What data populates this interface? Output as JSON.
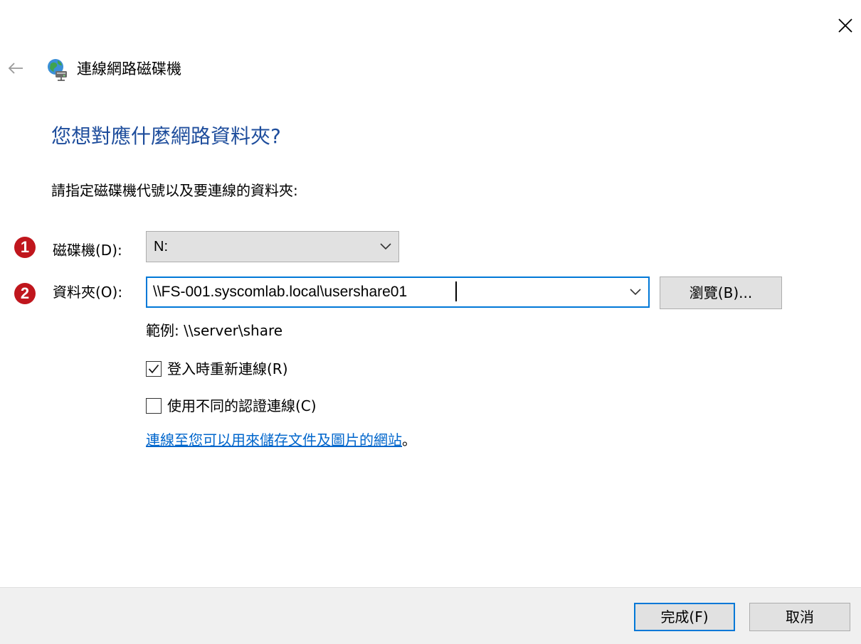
{
  "window": {
    "title": "連線網路磁碟機",
    "close_icon": "close-icon",
    "back_icon": "back-arrow-icon",
    "app_icon": "network-drive-icon"
  },
  "main": {
    "heading": "您想對應什麼網路資料夾?",
    "instruction": "請指定磁碟機代號以及要連線的資料夾:",
    "badges": [
      "1",
      "2"
    ],
    "drive": {
      "label": "磁碟機(D):",
      "value": "N:"
    },
    "folder": {
      "label": "資料夾(O):",
      "value": "\\\\FS-001.syscomlab.local\\usershare01"
    },
    "browse_label": "瀏覽(B)...",
    "example": "範例: \\\\server\\share",
    "reconnect": {
      "label": "登入時重新連線(R)",
      "checked": true
    },
    "different_creds": {
      "label": "使用不同的認證連線(C)",
      "checked": false
    },
    "link_text": "連線至您可以用來儲存文件及圖片的網站",
    "link_suffix": "。"
  },
  "footer": {
    "finish_label": "完成(F)",
    "cancel_label": "取消"
  },
  "colors": {
    "accent": "#0078d7",
    "heading": "#1e4d9c",
    "link": "#0066cc",
    "badge": "#c0161d"
  }
}
